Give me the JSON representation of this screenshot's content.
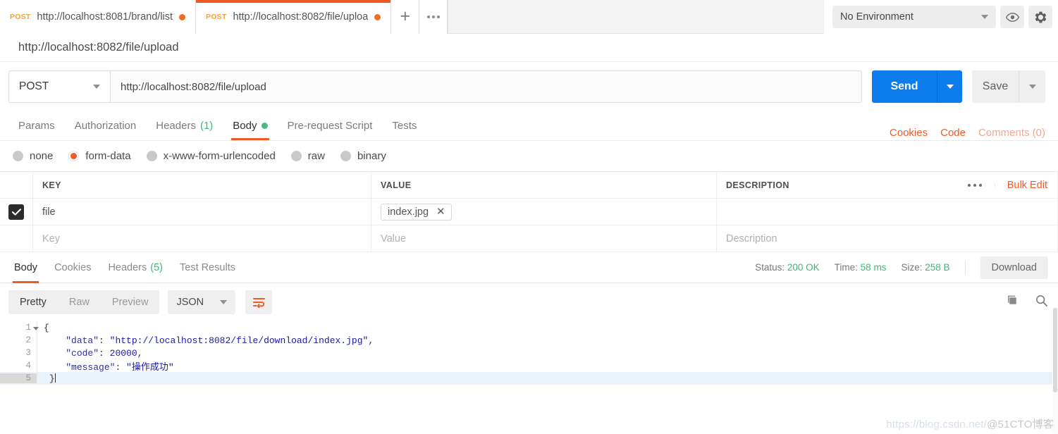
{
  "tabs": [
    {
      "method": "POST",
      "url": "http://localhost:8081/brand/list",
      "active": false,
      "unsaved": true
    },
    {
      "method": "POST",
      "url": "http://localhost:8082/file/uploa",
      "active": true,
      "unsaved": true
    }
  ],
  "tab_controls": {
    "new_tab": "+",
    "more": "•••"
  },
  "environment": {
    "selected": "No Environment",
    "eye_icon": "eye-icon",
    "gear_icon": "gear-icon"
  },
  "request": {
    "name": "http://localhost:8082/file/upload",
    "method": "POST",
    "url": "http://localhost:8082/file/upload",
    "send_label": "Send",
    "save_label": "Save"
  },
  "request_tabs": [
    {
      "label": "Params",
      "active": false
    },
    {
      "label": "Authorization",
      "active": false
    },
    {
      "label": "Headers",
      "count": "(1)",
      "active": false
    },
    {
      "label": "Body",
      "active": true,
      "dot": true
    },
    {
      "label": "Pre-request Script",
      "active": false
    },
    {
      "label": "Tests",
      "active": false
    }
  ],
  "request_tabs_right": {
    "cookies": "Cookies",
    "code": "Code",
    "comments": "Comments (0)"
  },
  "body_types": [
    {
      "label": "none",
      "selected": false
    },
    {
      "label": "form-data",
      "selected": true
    },
    {
      "label": "x-www-form-urlencoded",
      "selected": false
    },
    {
      "label": "raw",
      "selected": false
    },
    {
      "label": "binary",
      "selected": false
    }
  ],
  "kv_table": {
    "headers": {
      "key": "KEY",
      "value": "VALUE",
      "description": "DESCRIPTION"
    },
    "bulk_edit": "Bulk Edit",
    "rows": [
      {
        "checked": true,
        "key": "file",
        "value": "index.jpg",
        "value_is_file": true,
        "description": ""
      }
    ],
    "empty_row": {
      "key_placeholder": "Key",
      "value_placeholder": "Value",
      "description_placeholder": "Description"
    }
  },
  "response": {
    "tabs": [
      {
        "label": "Body",
        "active": true
      },
      {
        "label": "Cookies",
        "active": false
      },
      {
        "label": "Headers",
        "count": "(5)",
        "active": false
      },
      {
        "label": "Test Results",
        "active": false
      }
    ],
    "meta": {
      "status_label": "Status:",
      "status_value": "200 OK",
      "time_label": "Time:",
      "time_value": "58 ms",
      "size_label": "Size:",
      "size_value": "258 B"
    },
    "download_label": "Download",
    "view_modes": [
      {
        "label": "Pretty",
        "active": true
      },
      {
        "label": "Raw",
        "active": false
      },
      {
        "label": "Preview",
        "active": false
      }
    ],
    "format": "JSON",
    "wrap_icon": "text-wrap-icon",
    "copy_icon": "copy-icon",
    "search_icon": "search-icon",
    "code_lines": [
      {
        "n": "1",
        "fold": true,
        "segments": [
          {
            "t": "{",
            "c": "punc"
          }
        ]
      },
      {
        "n": "2",
        "fold": false,
        "indent": 4,
        "segments": [
          {
            "t": "\"data\"",
            "c": "key"
          },
          {
            "t": ": ",
            "c": "punc"
          },
          {
            "t": "\"http://localhost:8082/file/download/index.jpg\"",
            "c": "str"
          },
          {
            "t": ",",
            "c": "punc"
          }
        ]
      },
      {
        "n": "3",
        "fold": false,
        "indent": 4,
        "segments": [
          {
            "t": "\"code\"",
            "c": "key"
          },
          {
            "t": ": ",
            "c": "punc"
          },
          {
            "t": "20000",
            "c": "num"
          },
          {
            "t": ",",
            "c": "punc"
          }
        ]
      },
      {
        "n": "4",
        "fold": false,
        "indent": 4,
        "segments": [
          {
            "t": "\"message\"",
            "c": "key"
          },
          {
            "t": ": ",
            "c": "punc"
          },
          {
            "t": "\"操作成功\"",
            "c": "str"
          }
        ]
      },
      {
        "n": "5",
        "fold": false,
        "indent": 1,
        "cursor": true,
        "selected_gutter": true,
        "segments": [
          {
            "t": "}",
            "c": "punc"
          }
        ]
      }
    ]
  },
  "watermark": {
    "url": "https://blog.csdn.net/",
    "suffix": "@51CTO博客"
  },
  "colors": {
    "accent_orange": "#ef5b25",
    "send_blue": "#0d7ced",
    "status_green": "#3cb878",
    "method_amber": "#f0a13c"
  }
}
